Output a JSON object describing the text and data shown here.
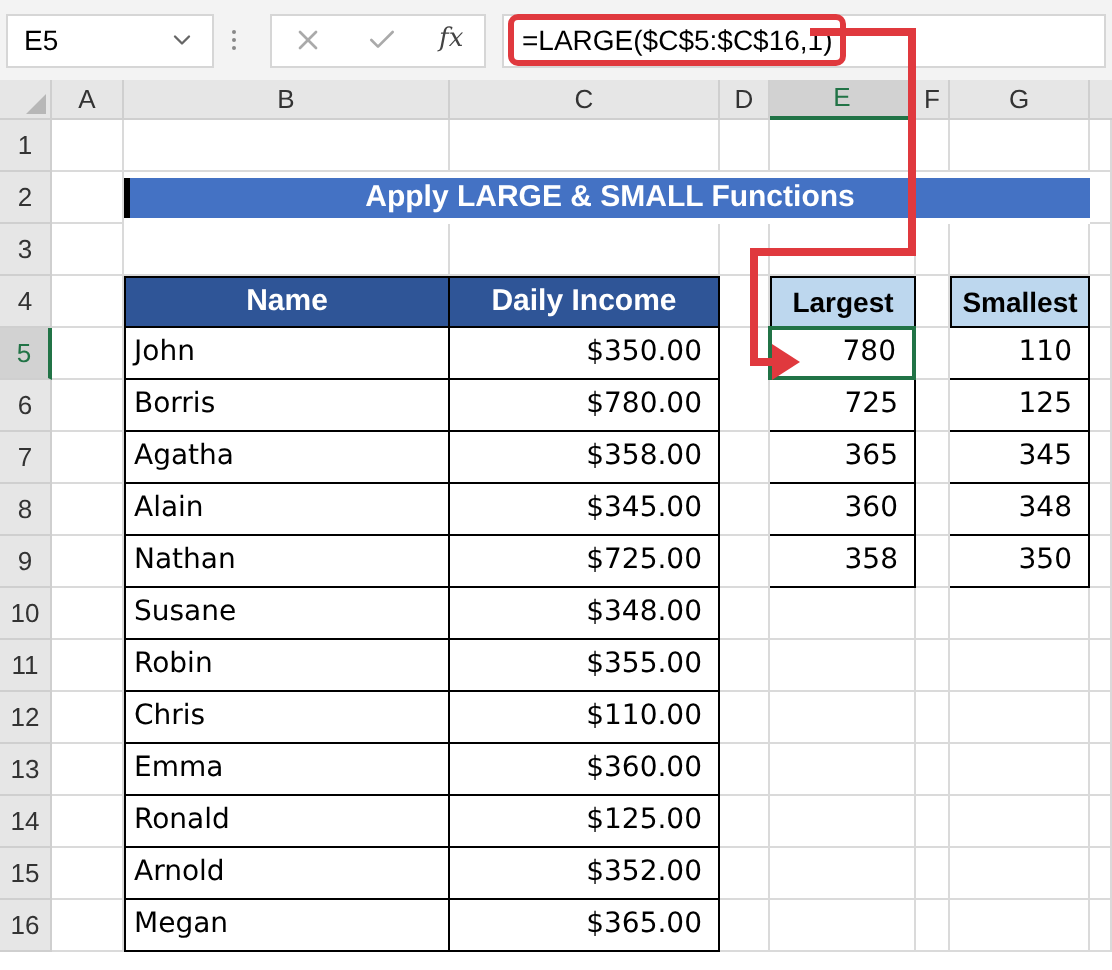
{
  "name_box": "E5",
  "function_label": "fx",
  "formula": "=LARGE($C$5:$C$16,1)",
  "columns": [
    {
      "label": "A",
      "selected": false
    },
    {
      "label": "B",
      "selected": false
    },
    {
      "label": "C",
      "selected": false
    },
    {
      "label": "D",
      "selected": false
    },
    {
      "label": "E",
      "selected": true
    },
    {
      "label": "F",
      "selected": false
    },
    {
      "label": "G",
      "selected": false
    }
  ],
  "rows": [
    {
      "label": "1",
      "selected": false
    },
    {
      "label": "2",
      "selected": false
    },
    {
      "label": "3",
      "selected": false
    },
    {
      "label": "4",
      "selected": false
    },
    {
      "label": "5",
      "selected": true
    },
    {
      "label": "6",
      "selected": false
    },
    {
      "label": "7",
      "selected": false
    },
    {
      "label": "8",
      "selected": false
    },
    {
      "label": "9",
      "selected": false
    },
    {
      "label": "10",
      "selected": false
    },
    {
      "label": "11",
      "selected": false
    },
    {
      "label": "12",
      "selected": false
    },
    {
      "label": "13",
      "selected": false
    },
    {
      "label": "14",
      "selected": false
    },
    {
      "label": "15",
      "selected": false
    },
    {
      "label": "16",
      "selected": false
    }
  ],
  "title": "Apply LARGE & SMALL Functions",
  "income_table": {
    "columns": [
      "Name",
      "Daily Income"
    ],
    "rows": [
      [
        "John",
        "$350.00"
      ],
      [
        "Borris",
        "$780.00"
      ],
      [
        "Agatha",
        "$358.00"
      ],
      [
        "Alain",
        "$345.00"
      ],
      [
        "Nathan",
        "$725.00"
      ],
      [
        "Susane",
        "$348.00"
      ],
      [
        "Robin",
        "$355.00"
      ],
      [
        "Chris",
        "$110.00"
      ],
      [
        "Emma",
        "$360.00"
      ],
      [
        "Ronald",
        "$125.00"
      ],
      [
        "Arnold",
        "$352.00"
      ],
      [
        "Megan",
        "$365.00"
      ]
    ]
  },
  "largest": {
    "header": "Largest",
    "values": [
      {
        "value": "780",
        "selected": true
      },
      {
        "value": "725",
        "selected": false
      },
      {
        "value": "365",
        "selected": false
      },
      {
        "value": "360",
        "selected": false
      },
      {
        "value": "358",
        "selected": false
      }
    ]
  },
  "smallest": {
    "header": "Smallest",
    "values": [
      {
        "value": "110",
        "selected": false
      },
      {
        "value": "125",
        "selected": false
      },
      {
        "value": "345",
        "selected": false
      },
      {
        "value": "348",
        "selected": false
      },
      {
        "value": "350",
        "selected": false
      }
    ]
  }
}
